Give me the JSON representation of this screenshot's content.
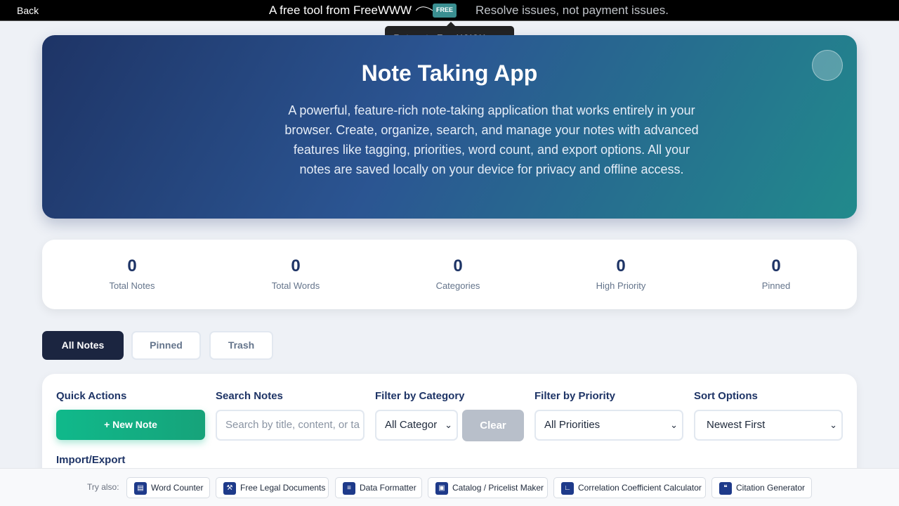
{
  "topbar": {
    "back_label": "Back",
    "brand_text": "A free tool from FreeWWW",
    "logo_text": "FREE",
    "tagline": "Resolve issues, not payment issues.",
    "tooltip": "Return to FreeWWW.com"
  },
  "hero": {
    "title": "Note Taking App",
    "description": "A powerful, feature-rich note-taking application that works entirely in your browser. Create, organize, search, and manage your notes with advanced features like tagging, priorities, word count, and export options. All your notes are saved locally on your device for privacy and offline access."
  },
  "stats": [
    {
      "value": "0",
      "label": "Total Notes"
    },
    {
      "value": "0",
      "label": "Total Words"
    },
    {
      "value": "0",
      "label": "Categories"
    },
    {
      "value": "0",
      "label": "High Priority"
    },
    {
      "value": "0",
      "label": "Pinned"
    }
  ],
  "tabs": [
    {
      "label": "All Notes",
      "active": true
    },
    {
      "label": "Pinned",
      "active": false
    },
    {
      "label": "Trash",
      "active": false
    }
  ],
  "controls": {
    "quick_actions_label": "Quick Actions",
    "new_note_label": "+ New Note",
    "search_label": "Search Notes",
    "search_placeholder": "Search by title, content, or ta",
    "category_label": "Filter by Category",
    "category_value": "All Categor",
    "clear_label": "Clear",
    "priority_label": "Filter by Priority",
    "priority_value": "All Priorities",
    "sort_label": "Sort Options",
    "sort_value": "Newest First",
    "import_export_label": "Import/Export"
  },
  "footer": {
    "try_label": "Try also:",
    "links": [
      {
        "label": "Word Counter",
        "icon": "document-icon"
      },
      {
        "label": "Free Legal Documents",
        "icon": "gavel-icon"
      },
      {
        "label": "Data Formatter",
        "icon": "list-icon"
      },
      {
        "label": "Catalog / Pricelist Maker",
        "icon": "catalog-icon"
      },
      {
        "label": "Correlation Coefficient Calculator",
        "icon": "chart-icon"
      },
      {
        "label": "Citation Generator",
        "icon": "quote-icon"
      }
    ]
  },
  "colors": {
    "hero_start": "#1e3466",
    "hero_end": "#218a8c",
    "primary_dark": "#1b2540",
    "accent_green": "#10b98b"
  }
}
